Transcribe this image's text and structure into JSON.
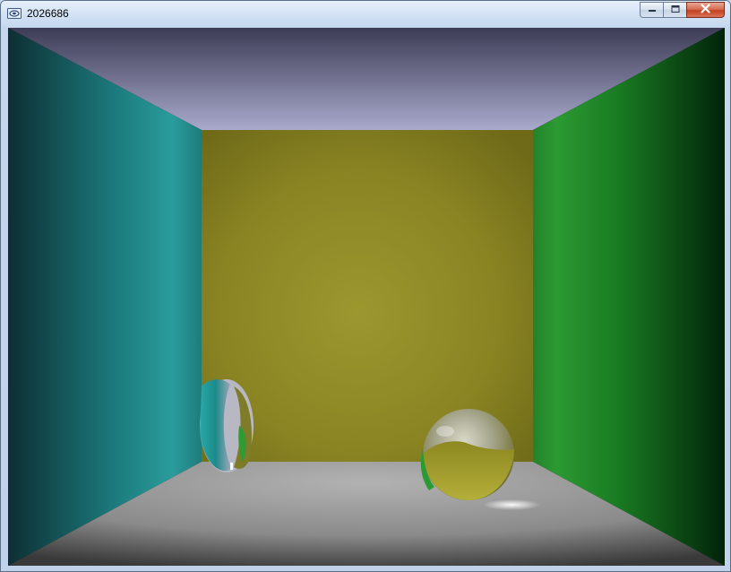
{
  "window": {
    "title": "2026686",
    "icons": {
      "app": "app-icon",
      "minimize": "minimize-icon",
      "maximize": "maximize-icon",
      "close": "close-icon"
    }
  },
  "scene": {
    "description_icon": "render-viewport",
    "colors": {
      "ceiling": "#9b9bbd",
      "back_wall": "#9a9430",
      "left_wall": "#2a9c9c",
      "right_wall": "#2a9a30",
      "floor": "#a8a8a8"
    }
  }
}
